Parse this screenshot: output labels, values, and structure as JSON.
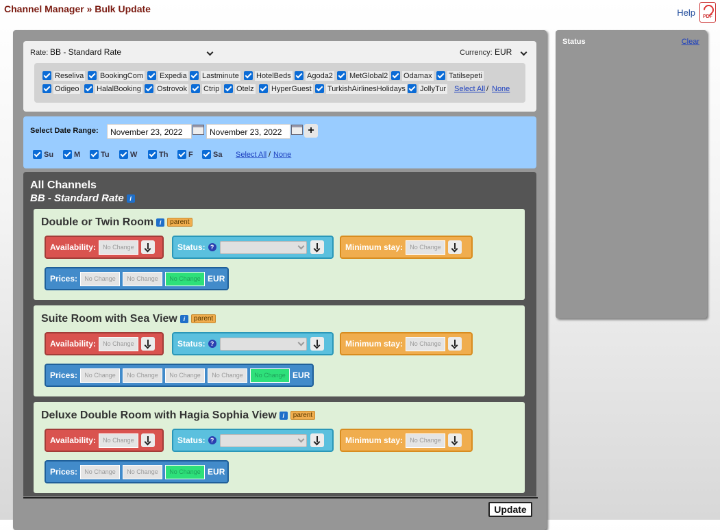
{
  "header": {
    "breadcrumb": "Channel Manager » Bulk Update",
    "help_label": "Help",
    "pdf_label": "PDF"
  },
  "rate": {
    "label": "Rate:",
    "selected": "BB - Standard Rate",
    "currency_label": "Currency:",
    "currency": "EUR"
  },
  "channels": {
    "row1": [
      "Reseliva",
      "BookingCom",
      "Expedia",
      "Lastminute",
      "HotelBeds",
      "Agoda2",
      "MetGlobal2",
      "Odamax",
      "Tatilsepeti"
    ],
    "row2": [
      "Odigeo",
      "HalalBooking",
      "Ostrovok",
      "Ctrip",
      "Otelz",
      "HyperGuest",
      "TurkishAirlinesHolidays",
      "JollyTur"
    ],
    "select_all": "Select All",
    "separator": "/",
    "none": "None"
  },
  "date_range": {
    "label": "Select Date Range:",
    "from": "November 23, 2022",
    "to": "November 23, 2022",
    "add": "+"
  },
  "days": {
    "items": [
      "Su",
      "M",
      "Tu",
      "W",
      "Th",
      "F",
      "Sa"
    ],
    "select_all": "Select All",
    "separator": "/",
    "none": "None"
  },
  "section": {
    "title": "All Channels",
    "rate_name": "BB - Standard Rate",
    "info_glyph": "i"
  },
  "labels": {
    "availability": "Availability:",
    "status": "Status:",
    "min_stay": "Minimum stay:",
    "prices": "Prices:",
    "no_change": "No Change",
    "currency": "EUR",
    "parent": "parent",
    "help_glyph": "?"
  },
  "rooms": [
    {
      "name": "Double or Twin Room",
      "price_fields": 3
    },
    {
      "name": "Suite Room with Sea View",
      "price_fields": 5
    },
    {
      "name": "Deluxe Double Room with Hagia Sophia View",
      "price_fields": 3
    }
  ],
  "status_panel": {
    "title": "Status",
    "clear": "Clear"
  },
  "actions": {
    "update": "Update"
  }
}
